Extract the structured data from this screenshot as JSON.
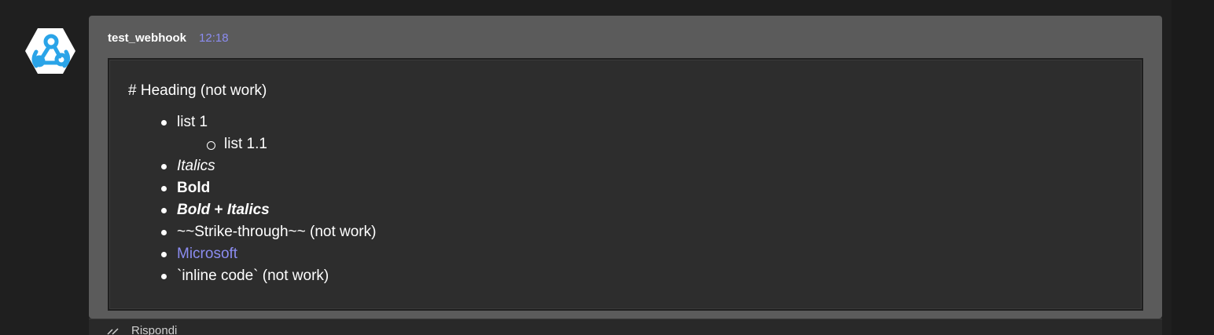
{
  "message": {
    "sender": "test_webhook",
    "time": "12:18",
    "avatar_icon": "webhook-icon",
    "heading_text": "# Heading (not work)",
    "items": {
      "list1": "list 1",
      "list11": "list 1.1",
      "italics": "Italics",
      "bold": "Bold",
      "bold_part": "Bold",
      "plus": " + ",
      "italics_part": "Italics",
      "strike": "~~Strike-through~~ (not work)",
      "link": "Microsoft",
      "inline_code": "`inline code` (not work)"
    }
  },
  "reply": {
    "label": "Rispondi",
    "icon": "reply-icon"
  },
  "colors": {
    "background": "#1f1f1f",
    "card": "#5b5b5b",
    "card_body": "#2d2d2d",
    "accent": "#8b8cf0"
  }
}
